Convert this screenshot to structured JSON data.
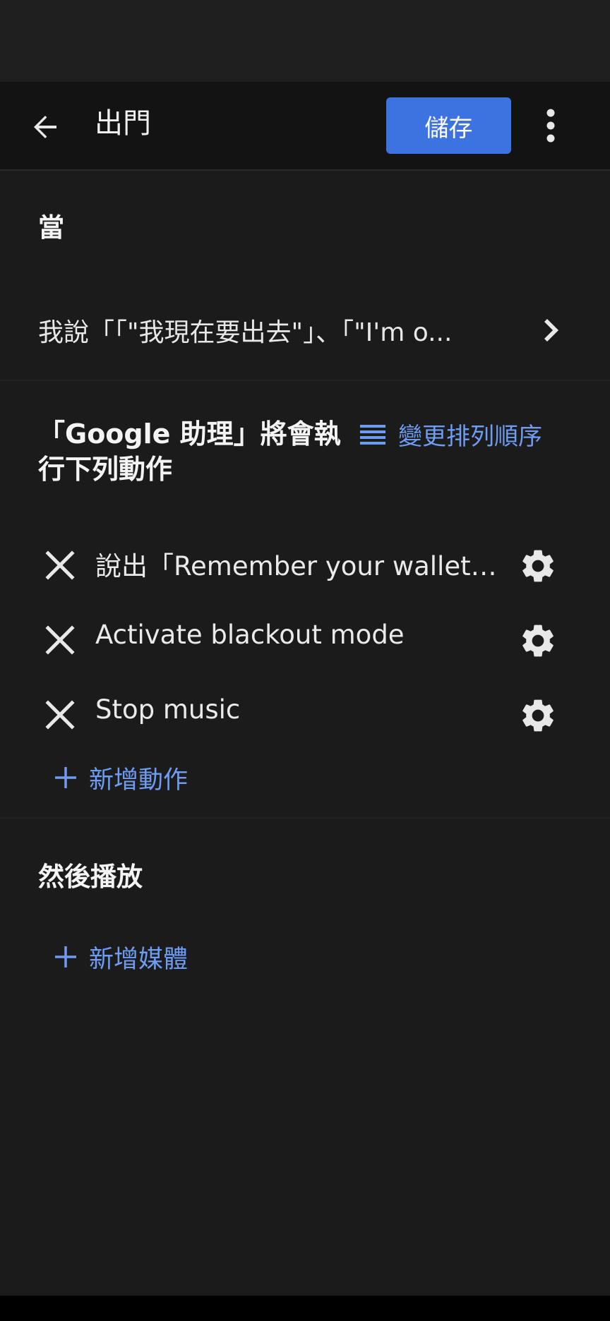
{
  "app_bar": {
    "title": "出門",
    "save_label": "儲存",
    "back_icon": "arrow-back-icon",
    "more_icon": "more-vertical-icon"
  },
  "when": {
    "title": "當",
    "trigger_text": "我說「「\"我現在要出去\"」、「\"I'm o...",
    "trigger_icon": "chevron-right-icon"
  },
  "actions": {
    "title": "「Google 助理」將會執行下列動作",
    "reorder_label": "變更排列順序",
    "items": [
      {
        "label": "說出「Remember your wallet, ..."
      },
      {
        "label": "Activate blackout mode"
      },
      {
        "label": "Stop music"
      }
    ],
    "add_label": "新增動作"
  },
  "then": {
    "title": "然後播放",
    "add_label": "新增媒體"
  },
  "colors": {
    "background": "#1b1b1b",
    "app_bar": "#131313",
    "accent": "#3d73e0",
    "link": "#6e9cf2",
    "text": "#e8e8e8"
  }
}
